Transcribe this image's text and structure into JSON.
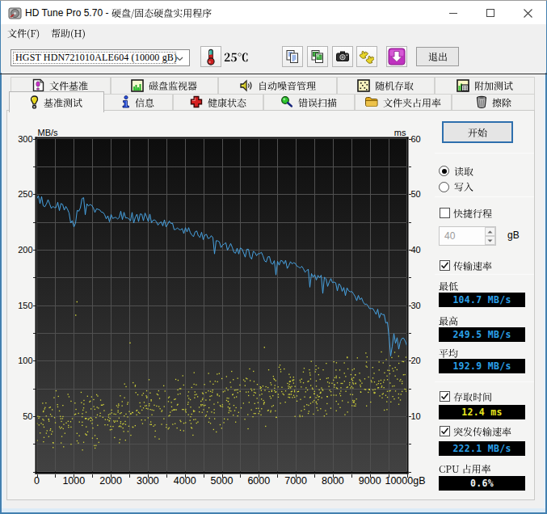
{
  "window": {
    "title": "HD Tune Pro 5.70 - 硬盘/固态硬盘实用程序",
    "title_latin": "HD Tune Pro 5.70 - "
  },
  "menu": {
    "items": [
      {
        "label": "文件(F)"
      },
      {
        "label": "帮助(H)"
      }
    ]
  },
  "toolbar": {
    "drive_select_value": "HGST HDN721010ALE604 (10000 gB)",
    "temperature": "25℃",
    "buttons": [
      {
        "icon": "copy-text-icon"
      },
      {
        "icon": "copy-image-icon"
      },
      {
        "icon": "camera-icon"
      },
      {
        "icon": "donate-hands-icon"
      },
      {
        "icon": "update-download-icon"
      }
    ],
    "exit_label": "退出"
  },
  "tabs": {
    "row1": [
      {
        "label": "文件基准",
        "icon": "file-benchmark-icon"
      },
      {
        "label": "磁盘监视器",
        "icon": "disk-monitor-icon"
      },
      {
        "label": "自动噪音管理",
        "icon": "speaker-icon"
      },
      {
        "label": "随机存取",
        "icon": "random-access-icon"
      },
      {
        "label": "附加测试",
        "icon": "extra-tests-icon"
      }
    ],
    "row2": [
      {
        "label": "基准测试",
        "icon": "exclamation-icon",
        "active": true
      },
      {
        "label": "信息",
        "icon": "info-icon"
      },
      {
        "label": "健康状态",
        "icon": "health-cross-icon"
      },
      {
        "label": "错误扫描",
        "icon": "magnifier-icon"
      },
      {
        "label": "文件夹占用率",
        "icon": "folder-icon"
      },
      {
        "label": "擦除",
        "icon": "trash-icon"
      }
    ],
    "active_tab": "基准测试"
  },
  "controls": {
    "start_label": "开始",
    "read_label": "读取",
    "write_label": "写入",
    "short_stroke_label": "快捷行程",
    "short_stroke_value": "40",
    "short_stroke_unit": "gB",
    "transfer_rate_label": "传输速率",
    "minimum_label": "最低",
    "minimum_value": "104.7 MB/s",
    "maximum_label": "最高",
    "maximum_value": "249.5 MB/s",
    "average_label": "平均",
    "average_value": "192.9 MB/s",
    "access_time_label": "存取时间",
    "access_time_value": "12.4 ms",
    "burst_rate_label": "突发传输速率",
    "burst_rate_value": "222.1 MB/s",
    "cpu_usage_label": "CPU 占用率",
    "cpu_usage_value": "0.6%"
  },
  "chart_data": {
    "type": "line+scatter",
    "x_axis": {
      "range": [
        0,
        10000
      ],
      "tick_step": 1000,
      "grid_step": 500,
      "unit": "gB",
      "last_tick_label": "10000gB"
    },
    "left_axis": {
      "label": "MB/s",
      "range": [
        0,
        300
      ],
      "tick_step": 50,
      "grid_step": 25
    },
    "right_axis": {
      "label": "ms",
      "range": [
        0,
        60
      ],
      "tick_step": 10
    },
    "background": {
      "top": "#0d0d0d",
      "bottom": "#424242",
      "grid": "#505050"
    },
    "series": [
      {
        "name": "transfer-rate",
        "axis": "left",
        "unit": "MB/s",
        "color": "#48a3e2",
        "x": [
          0,
          150,
          300,
          500,
          700,
          850,
          950,
          1050,
          1150,
          1250,
          1400,
          1500,
          1750,
          2000,
          2250,
          2500,
          2750,
          3000,
          3250,
          3500,
          3750,
          4000,
          4250,
          4500,
          4750,
          5000,
          5250,
          5500,
          5750,
          6000,
          6250,
          6500,
          6750,
          7000,
          7250,
          7500,
          7750,
          8000,
          8250,
          8500,
          8750,
          9000,
          9200,
          9350,
          9500,
          9560,
          9650,
          9800,
          9900,
          10000
        ],
        "values": [
          249,
          243,
          242,
          240,
          238,
          233,
          223,
          226,
          240,
          243,
          239,
          237,
          234,
          232,
          231,
          230,
          229,
          229,
          226,
          223,
          221,
          218,
          215,
          211,
          208,
          205,
          202,
          199,
          196,
          194,
          192,
          190,
          187,
          184,
          180,
          176,
          172,
          169,
          164,
          160,
          155,
          150,
          144,
          139,
          133,
          107,
          126,
          112,
          121,
          113
        ],
        "noise_amp": 4.3,
        "spike_prob": 0.055,
        "spike_max": 10
      },
      {
        "name": "access-time",
        "axis": "right",
        "unit": "ms",
        "color": "#d5d63a",
        "scatter_band": {
          "start_ms": 8.4,
          "end_ms": 16.9,
          "spread_ms": 6.0,
          "count": 840
        },
        "outliers": [
          [
            1085,
            30.6
          ],
          [
            1050,
            28.2
          ],
          [
            2520,
            23.2
          ],
          [
            6150,
            22.4
          ]
        ]
      }
    ],
    "stats": {
      "minimum": "104.7 MB/s",
      "maximum": "249.5 MB/s",
      "average": "192.9 MB/s",
      "access_time": "12.4 ms",
      "burst_rate": "222.1 MB/s",
      "cpu_usage": "0.6%"
    }
  }
}
